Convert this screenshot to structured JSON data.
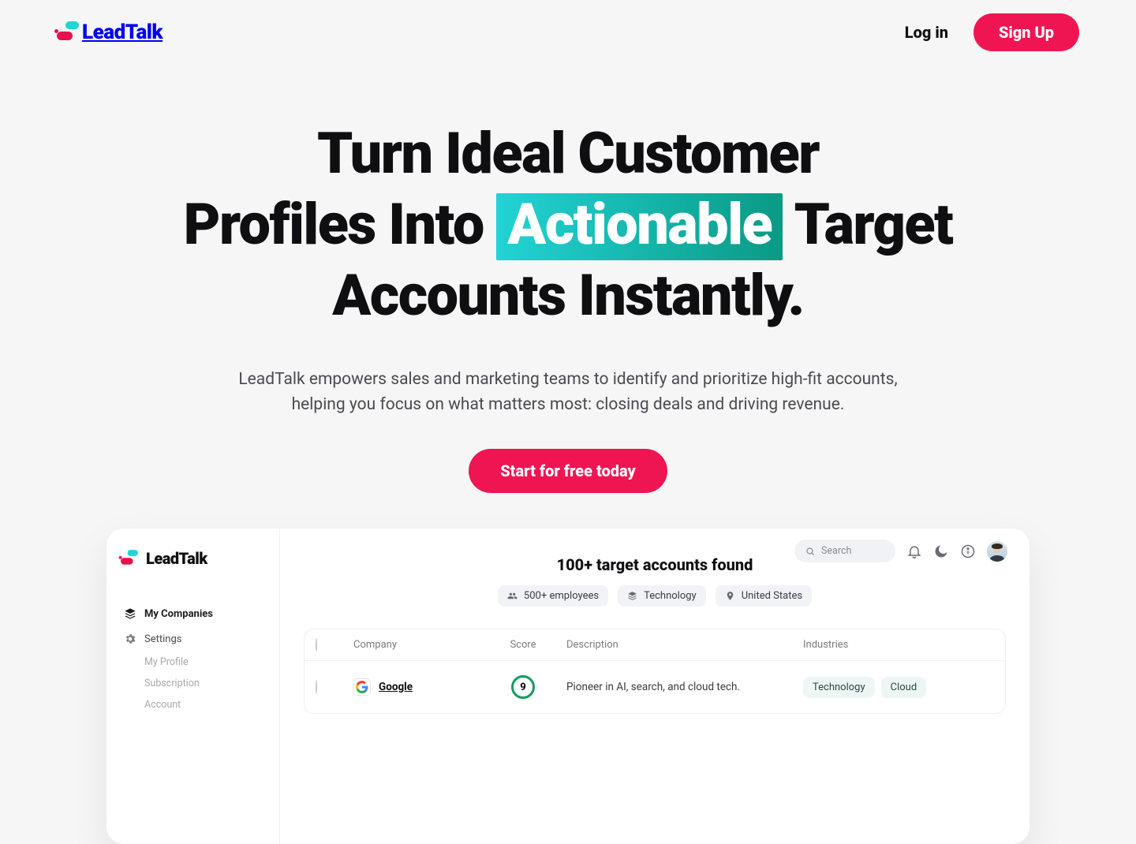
{
  "nav": {
    "brand": "LeadTalk",
    "login": "Log in",
    "signup": "Sign Up"
  },
  "hero": {
    "line1": "Turn Ideal Customer",
    "line2a": "Profiles Into",
    "highlight": "Actionable",
    "line2b": "Target",
    "line3": "Accounts Instantly.",
    "sub": "LeadTalk empowers sales and marketing teams to identify and prioritize high-fit accounts, helping you focus on what matters most: closing deals and driving revenue.",
    "cta": "Start for free today"
  },
  "preview": {
    "brand": "LeadTalk",
    "sidebar": {
      "items": [
        {
          "label": "My Companies"
        },
        {
          "label": "Settings"
        }
      ],
      "subs": [
        {
          "label": "My Profile"
        },
        {
          "label": "Subscription"
        },
        {
          "label": "Account"
        }
      ]
    },
    "search_placeholder": "Search",
    "results_title": "100+ target accounts found",
    "filters": [
      {
        "label": "500+ employees"
      },
      {
        "label": "Technology"
      },
      {
        "label": "United States"
      }
    ],
    "columns": {
      "company": "Company",
      "score": "Score",
      "description": "Description",
      "industries": "Industries"
    },
    "row": {
      "company": "Google",
      "score": "9",
      "description": "Pioneer in AI, search, and cloud tech.",
      "industries": [
        "Technology",
        "Cloud"
      ]
    }
  }
}
